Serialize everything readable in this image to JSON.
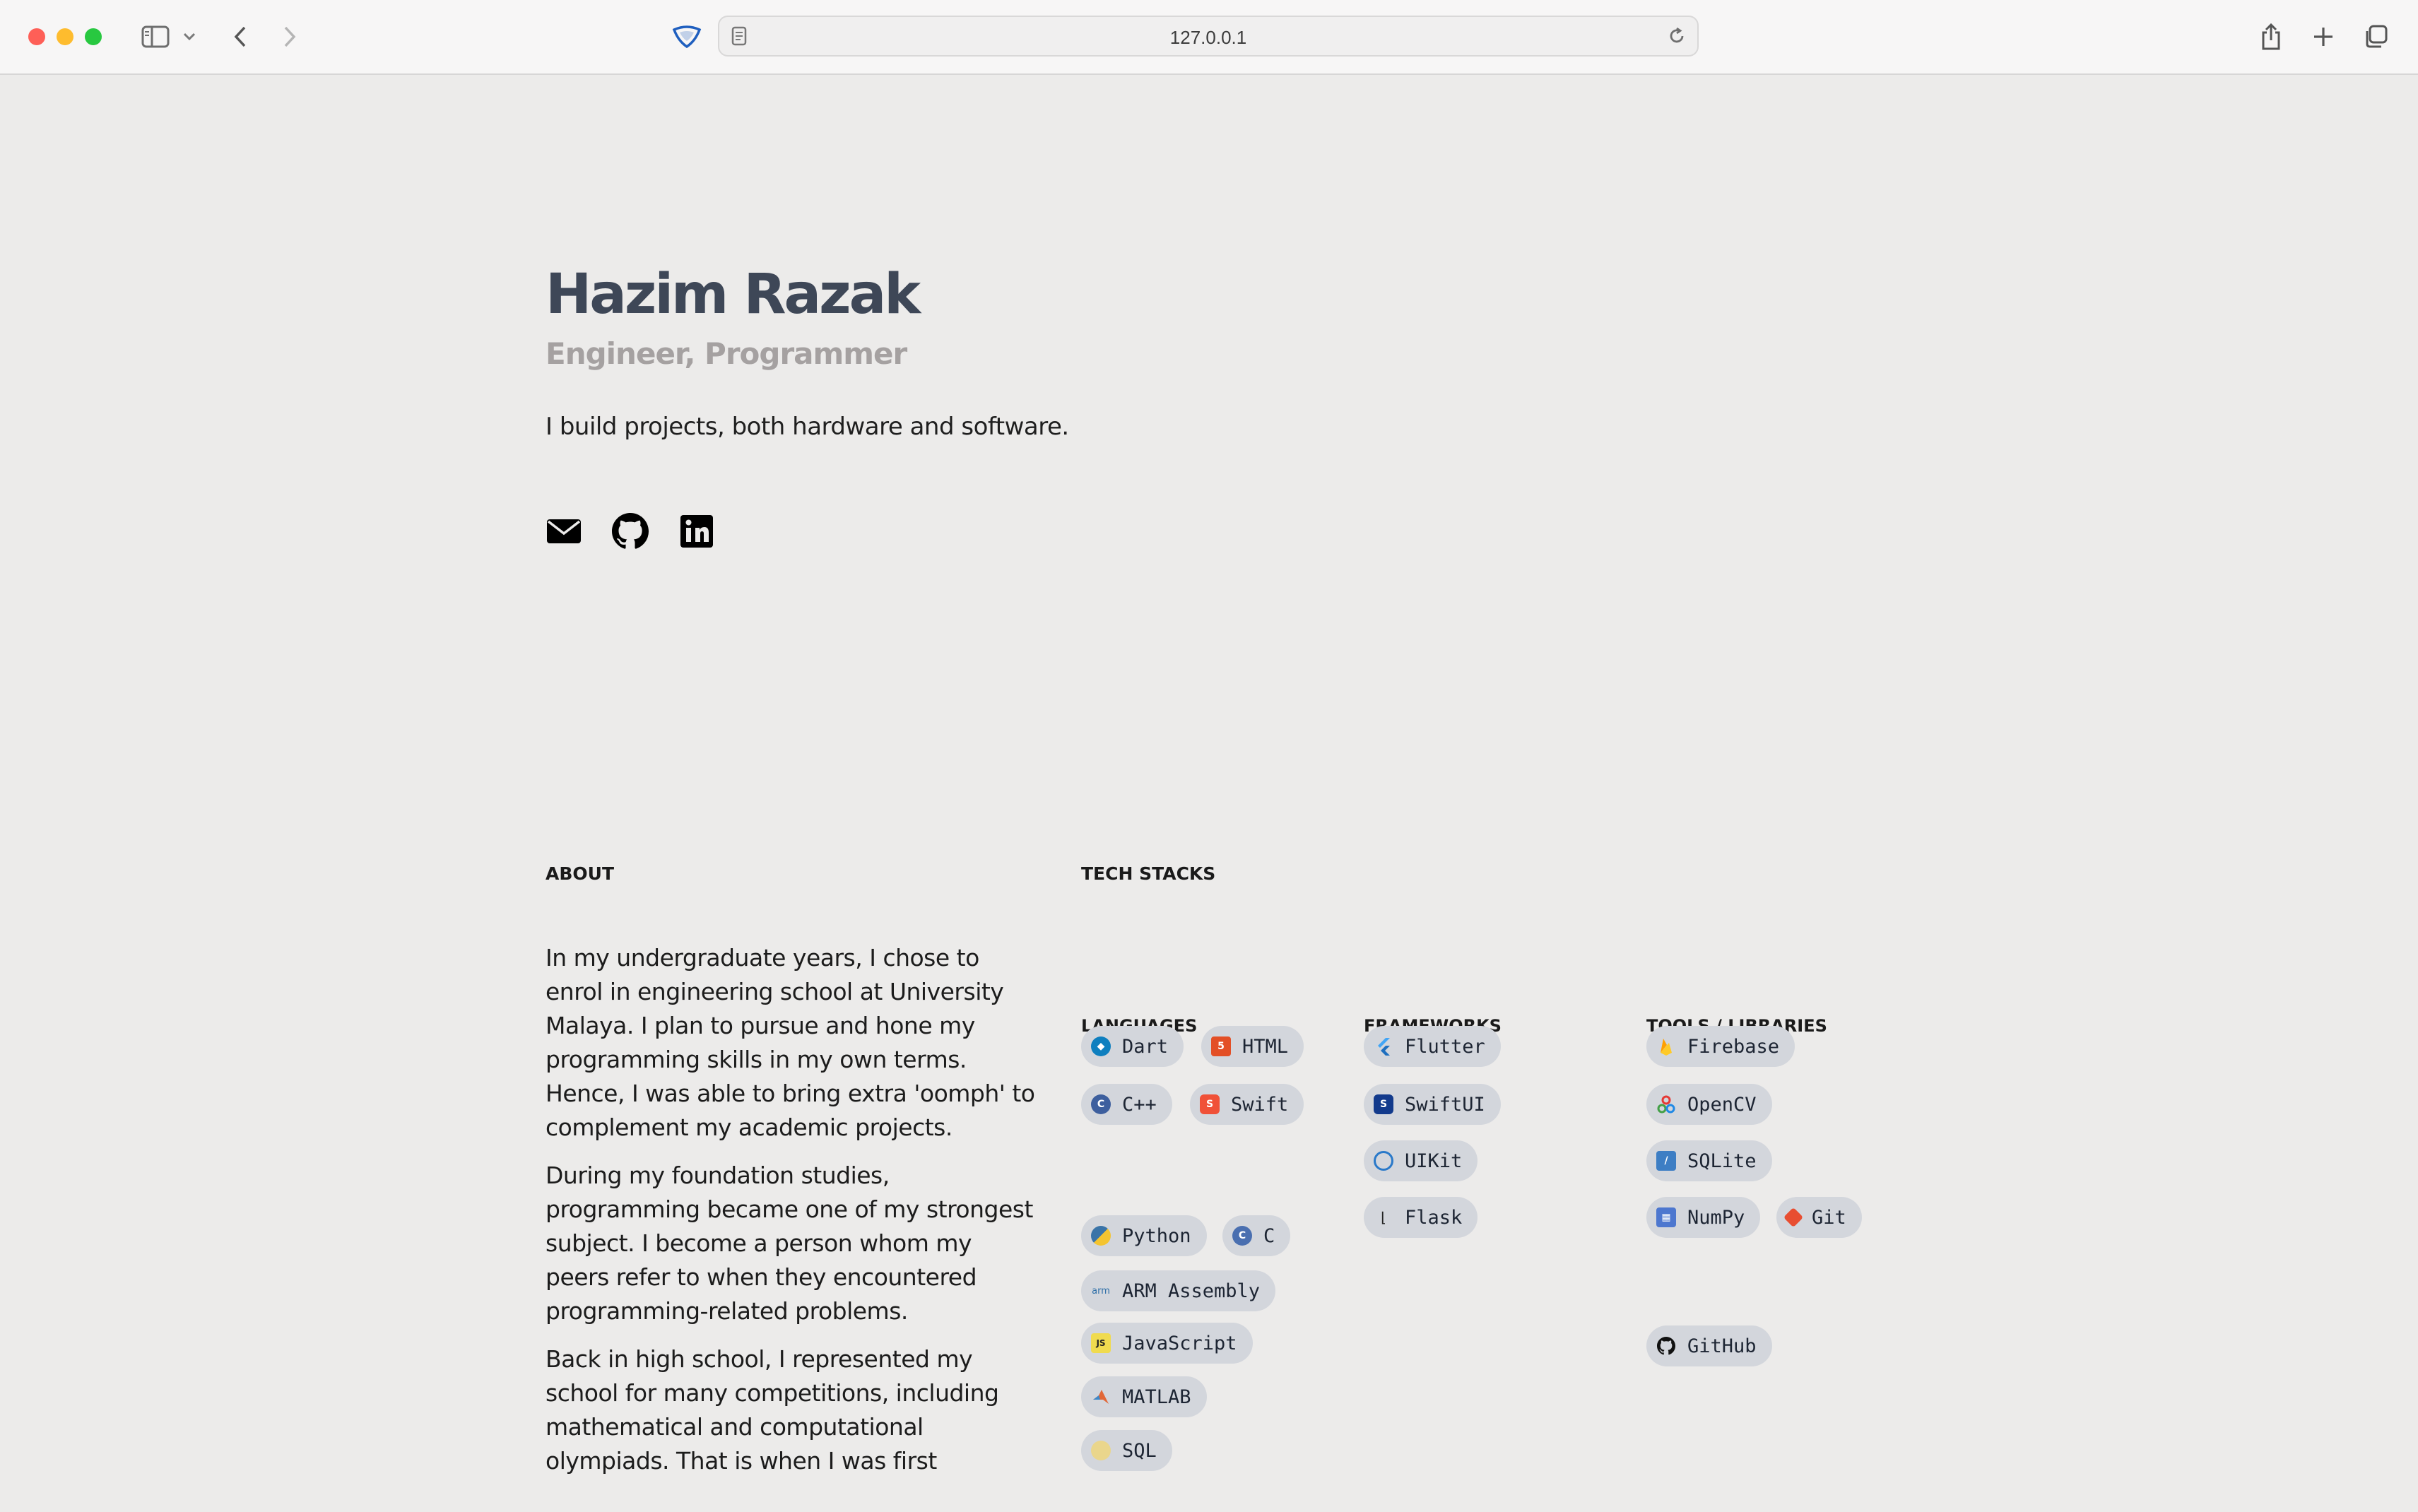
{
  "browser": {
    "url": "127.0.0.1"
  },
  "profile": {
    "name": "Hazim Razak",
    "role": "Engineer, Programmer",
    "tagline": "I build projects, both hardware and software."
  },
  "socials": [
    {
      "icon": "email-icon"
    },
    {
      "icon": "github-icon"
    },
    {
      "icon": "linkedin-icon"
    }
  ],
  "about": {
    "heading": "ABOUT",
    "paragraphs": [
      "In my undergraduate years, I chose to enrol in engineering school at University Malaya. I plan to pursue and hone my programming skills in my own terms. Hence, I was able to bring extra 'oomph' to complement my academic projects.",
      "During my foundation studies, programming became one of my strongest subject. I become a person whom my peers refer to when they encountered programming-related problems.",
      "Back in high school, I represented my school for many competitions, including mathematical and computational olympiads. That is when I was first"
    ]
  },
  "tech": {
    "heading": "TECH STACKS",
    "languages": {
      "heading": "LANGUAGES",
      "items": [
        "Dart",
        "HTML",
        "C++",
        "Swift",
        "Python",
        "C",
        "ARM Assembly",
        "JavaScript",
        "MATLAB",
        "SQL"
      ]
    },
    "frameworks": {
      "heading": "FRAMEWORKS",
      "items": [
        "Flutter",
        "SwiftUI",
        "UIKit",
        "Flask"
      ]
    },
    "tools": {
      "heading": "TOOLS / LIBRARIES",
      "items": [
        "Firebase",
        "OpenCV",
        "SQLite",
        "NumPy",
        "Git",
        "GitHub"
      ]
    }
  },
  "colors": {
    "name": "#3e4757",
    "role": "#a5a1a1",
    "badge_bg": "#d3d6dc",
    "page_bg": "#ecebea"
  }
}
